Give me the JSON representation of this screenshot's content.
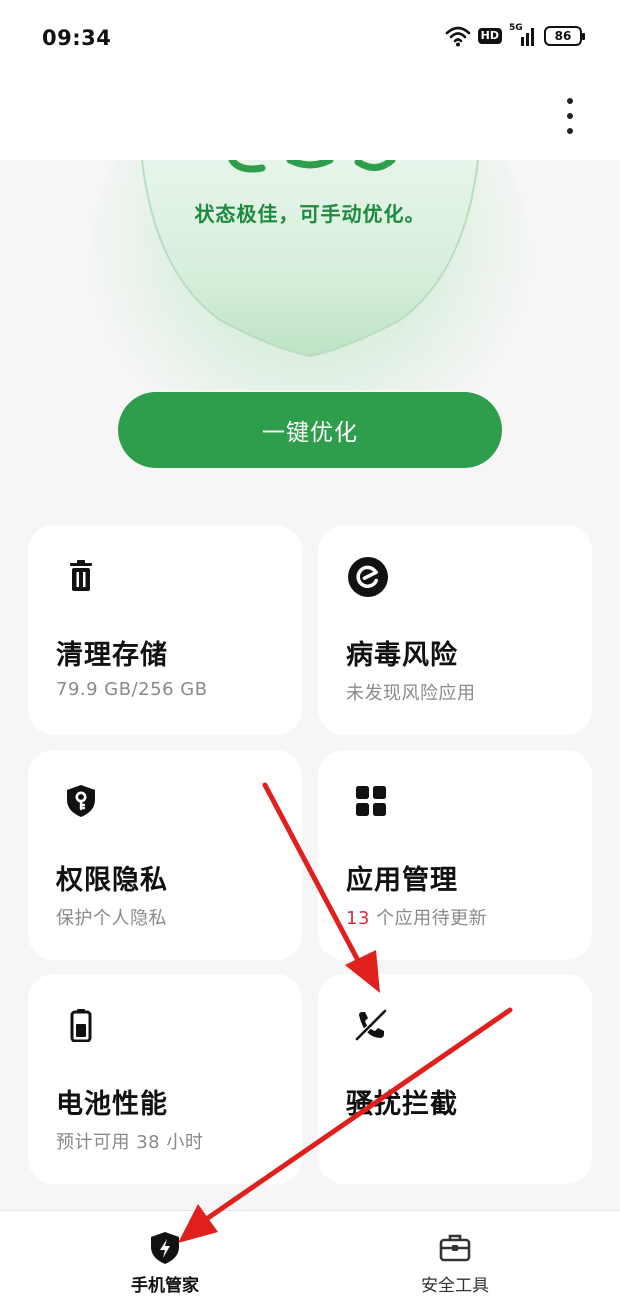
{
  "status_bar": {
    "time": "09:34",
    "hd_label": "HD",
    "network_label": "5G",
    "battery_level": "86",
    "icons": [
      "wifi-icon",
      "hd-icon",
      "signal-5g-icon",
      "battery-icon"
    ]
  },
  "app_bar": {
    "more_icon": "more-vertical-icon"
  },
  "hero": {
    "status_text": "状态极佳，可手动优化。",
    "accent_color": "#2e9e4c"
  },
  "optimize_button": {
    "label": "一键优化"
  },
  "cards": [
    {
      "id": "storage",
      "icon": "trash-icon",
      "title": "清理存储",
      "subtitle": "79.9 GB/256 GB"
    },
    {
      "id": "virus",
      "icon": "virus-scan-icon",
      "title": "病毒风险",
      "subtitle": "未发现风险应用"
    },
    {
      "id": "privacy",
      "icon": "shield-key-icon",
      "title": "权限隐私",
      "subtitle": "保护个人隐私"
    },
    {
      "id": "apps",
      "icon": "grid-icon",
      "title": "应用管理",
      "subtitle_count": "13",
      "subtitle_rest": " 个应用待更新"
    },
    {
      "id": "battery",
      "icon": "battery-icon",
      "title": "电池性能",
      "subtitle": "预计可用 38 小时"
    },
    {
      "id": "block",
      "icon": "call-block-icon",
      "title": "骚扰拦截",
      "subtitle": ""
    }
  ],
  "bottom_nav": [
    {
      "id": "phone-manager",
      "icon": "shield-bolt-icon",
      "label": "手机管家",
      "active": true
    },
    {
      "id": "security-tools",
      "icon": "toolbox-icon",
      "label": "安全工具",
      "active": false
    }
  ],
  "annotation_color": "#e0201c"
}
